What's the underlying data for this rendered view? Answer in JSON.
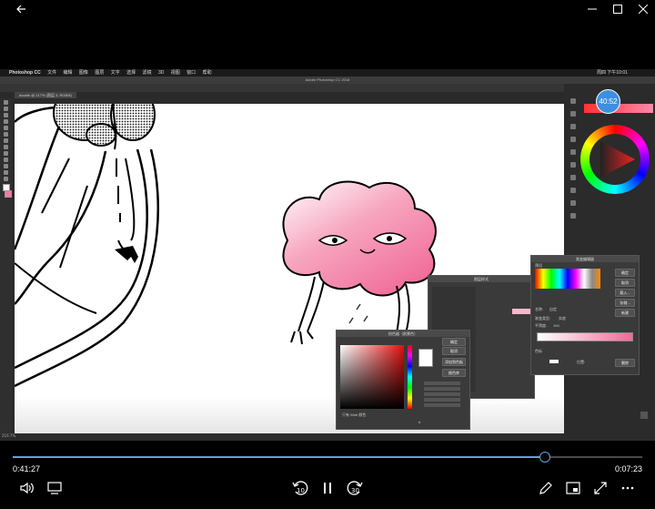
{
  "window": {
    "back_icon": "back-arrow-icon",
    "minimize_icon": "minimize-icon",
    "maximize_icon": "maximize-icon",
    "close_icon": "close-icon"
  },
  "photoshop": {
    "app_menu": [
      "Photoshop CC",
      "文件",
      "编辑",
      "图像",
      "图层",
      "文字",
      "选择",
      "滤镜",
      "3D",
      "视图",
      "窗口",
      "帮助"
    ],
    "window_title": "Adobe Photoshop CC 2018",
    "menubar_time": "周四 下午10:01",
    "doc_tab": "doodle @ 217% (图层 3, RGB/8)",
    "zoom_status": "216.7%",
    "clock_overlay": "40:52"
  },
  "dialogs": {
    "color_picker": {
      "title": "拾色器（前景色）",
      "ok": "确定",
      "cancel": "取消",
      "add_swatch": "添加到色板",
      "color_library": "颜色库",
      "web_only": "只有 Web 颜色",
      "hex_label": "#"
    },
    "gradient_editor": {
      "title": "渐变编辑器",
      "presets_label": "预设",
      "ok": "确定",
      "cancel": "取消",
      "load": "载入...",
      "save": "存储...",
      "new": "新建",
      "name_label": "名称:",
      "name_value": "自定",
      "gradient_type_label": "渐变类型:",
      "gradient_type_value": "实底",
      "smoothness_label": "平滑度:",
      "smoothness_value": "100",
      "color_stop_label": "色标",
      "location_label": "位置:",
      "delete_label": "删除"
    },
    "layer_style": {
      "title": "图层样式"
    }
  },
  "player": {
    "elapsed": "0:41:27",
    "remaining": "0:07:23",
    "progress": 0.845,
    "accent": "#5aa3ea",
    "rewind_seconds": "10",
    "forward_seconds": "30"
  }
}
